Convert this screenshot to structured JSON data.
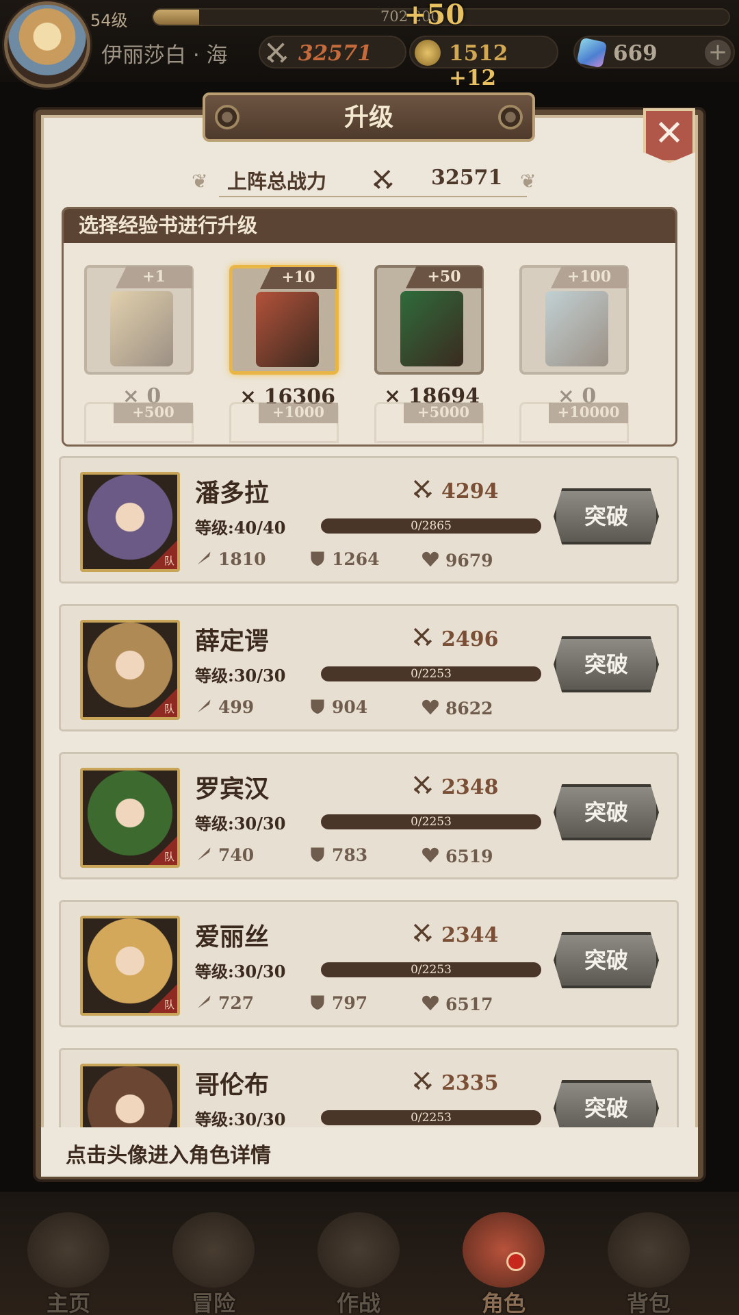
{
  "hud": {
    "level": "54级",
    "xp_text": "702",
    "xp_text2": "200",
    "xp_plus": "+50",
    "xp_progress": 0.08,
    "player_name": "伊丽莎白 · 海",
    "power": "32571",
    "gold": "1512",
    "gold_plus": "+12",
    "gems": "669",
    "gem_add": "+"
  },
  "panel": {
    "title": "升级",
    "close": "✕",
    "total_power_label": "上阵总战力",
    "total_power_value": "32571",
    "books_header": "选择经验书进行升级",
    "books": [
      {
        "tag": "+1",
        "count": "× 0",
        "color": "#d7b979"
      },
      {
        "tag": "+10",
        "count": "× 16306",
        "color": "#b3523a"
      },
      {
        "tag": "+50",
        "count": "× 18694",
        "color": "#2f6c3b"
      },
      {
        "tag": "+100",
        "count": "× 0",
        "color": "#8fb8cf"
      }
    ],
    "more_books": [
      "+500",
      "+1000",
      "+5000",
      "+10000"
    ],
    "footer_hint": "点击头像进入角色详情"
  },
  "heroes": [
    {
      "name": "潘多拉",
      "level": "等级:40/40",
      "power": "4294",
      "xp": "0/2865",
      "atk": "1810",
      "def": "1264",
      "hp": "9679",
      "button": "突破",
      "badge": "队",
      "bg": "#6b5a85"
    },
    {
      "name": "薛定谔",
      "level": "等级:30/30",
      "power": "2496",
      "xp": "0/2253",
      "atk": "499",
      "def": "904",
      "hp": "8622",
      "button": "突破",
      "badge": "队",
      "bg": "#b08a55"
    },
    {
      "name": "罗宾汉",
      "level": "等级:30/30",
      "power": "2348",
      "xp": "0/2253",
      "atk": "740",
      "def": "783",
      "hp": "6519",
      "button": "突破",
      "badge": "队",
      "bg": "#3d6a2e"
    },
    {
      "name": "爱丽丝",
      "level": "等级:30/30",
      "power": "2344",
      "xp": "0/2253",
      "atk": "727",
      "def": "797",
      "hp": "6517",
      "button": "突破",
      "badge": "队",
      "bg": "#d3a85a"
    },
    {
      "name": "哥伦布",
      "level": "等级:30/30",
      "power": "2335",
      "xp": "0/2253",
      "atk": "",
      "def": "",
      "hp": "",
      "button": "突破",
      "badge": "队",
      "bg": "#6b4632"
    }
  ],
  "nav": [
    {
      "label": "主页",
      "icon": "castle-icon"
    },
    {
      "label": "冒险",
      "icon": "adventure-icon"
    },
    {
      "label": "作战",
      "icon": "battle-icon"
    },
    {
      "label": "角色",
      "icon": "character-book-icon",
      "active": true
    },
    {
      "label": "背包",
      "icon": "backpack-icon"
    }
  ],
  "colors": {
    "accent": "#e9b544",
    "panel": "#ede6da",
    "dark": "#5b4434"
  }
}
